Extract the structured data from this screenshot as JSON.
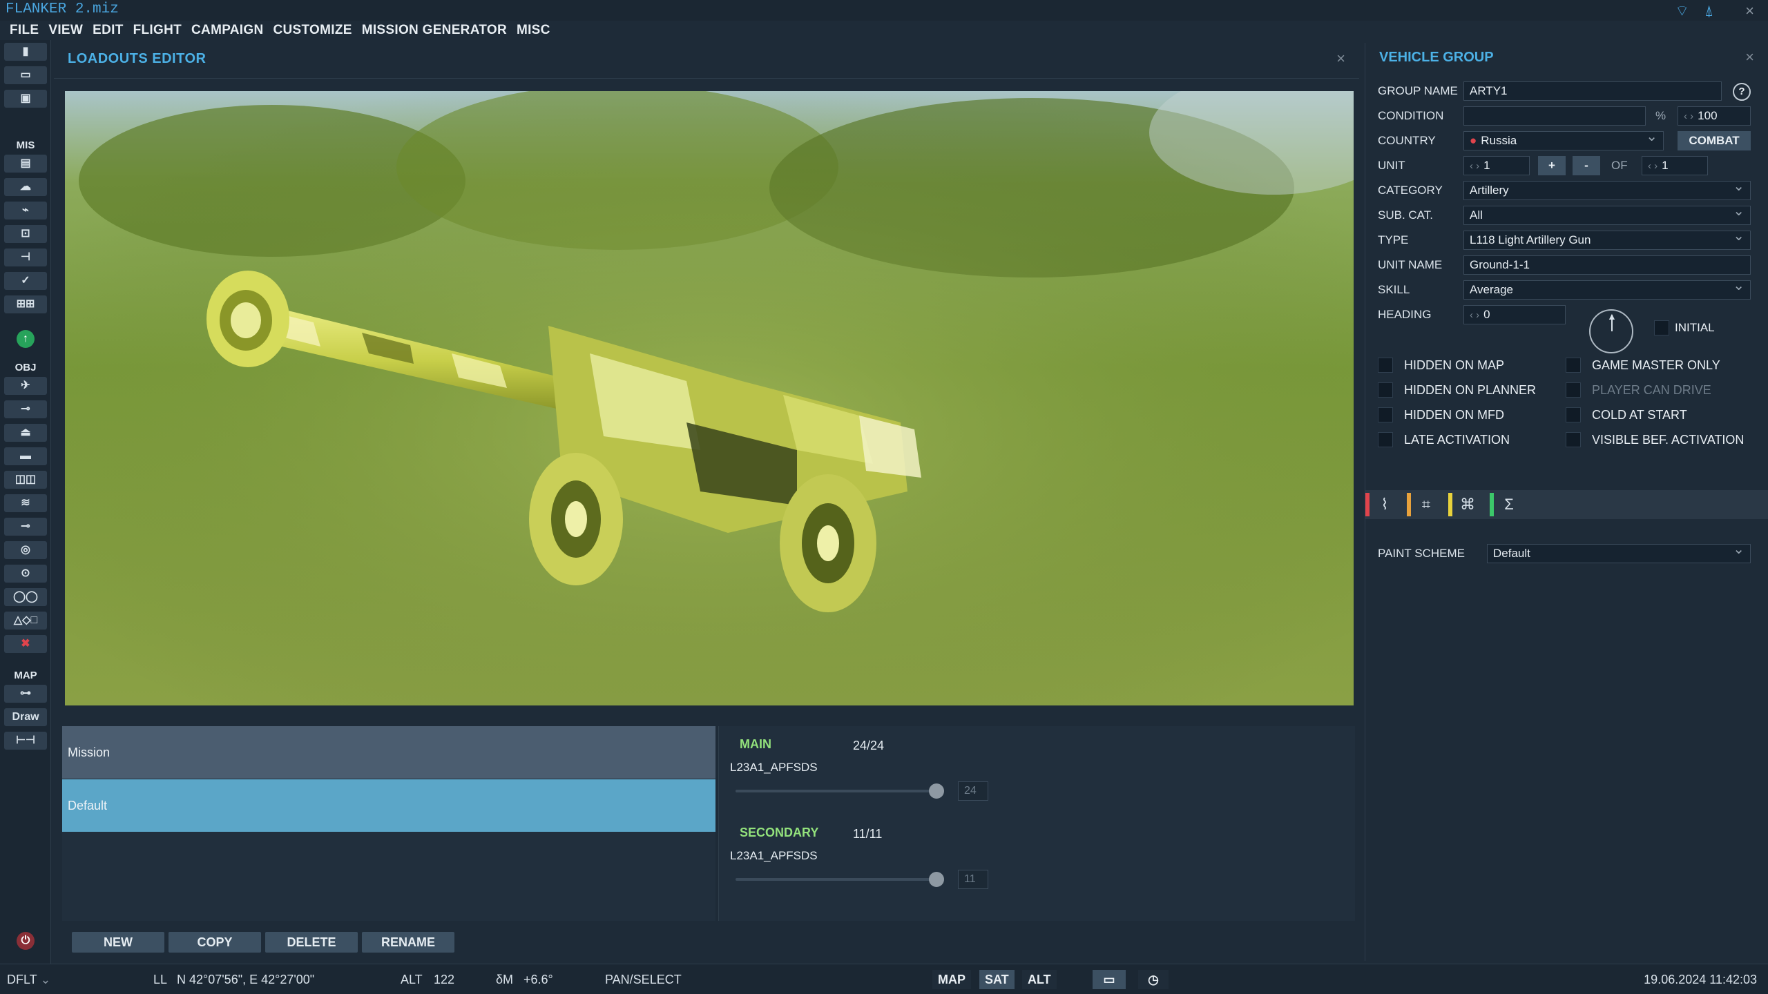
{
  "app": {
    "title": "FLANKER 2.miz"
  },
  "titlebar_icons": {
    "wifi": "wifi-icon",
    "antenna": "antenna-icon",
    "close": "×"
  },
  "menu": [
    "FILE",
    "VIEW",
    "EDIT",
    "FLIGHT",
    "CAMPAIGN",
    "CUSTOMIZE",
    "MISSION GENERATOR",
    "MISC"
  ],
  "left_toolbar": {
    "section_mis": "MIS",
    "section_obj": "OBJ",
    "section_map": "MAP",
    "draw_label": "Draw"
  },
  "loadouts": {
    "title": "LOADOUTS EDITOR",
    "close": "×",
    "list": [
      "Mission",
      "Default"
    ],
    "selected": "Default",
    "main": {
      "label": "MAIN",
      "count": "24/24",
      "weapon": "L23A1_APFSDS",
      "value": "24",
      "fraction": 1.0
    },
    "secondary": {
      "label": "SECONDARY",
      "count": "11/11",
      "weapon": "L23A1_APFSDS",
      "value": "11",
      "fraction": 1.0
    },
    "buttons": {
      "new": "NEW",
      "copy": "COPY",
      "delete": "DELETE",
      "rename": "RENAME"
    }
  },
  "vehicle_group": {
    "title": "VEHICLE GROUP",
    "close": "×",
    "labels": {
      "group_name": "GROUP NAME",
      "condition": "CONDITION",
      "country": "COUNTRY",
      "unit": "UNIT",
      "category": "CATEGORY",
      "sub_cat": "SUB. CAT.",
      "type": "TYPE",
      "unit_name": "UNIT NAME",
      "skill": "SKILL",
      "heading": "HEADING",
      "initial": "INITIAL",
      "of": "OF",
      "percent": "%",
      "paint_scheme": "PAINT SCHEME"
    },
    "values": {
      "group_name": "ARTY1",
      "condition": "",
      "condition_pct": "100",
      "country": "Russia",
      "unit": "1",
      "unit_of": "1",
      "category": "Artillery",
      "sub_cat": "All",
      "type": "L118 Light Artillery Gun",
      "unit_name": "Ground-1-1",
      "skill": "Average",
      "heading": "0",
      "paint_scheme": "Default"
    },
    "buttons": {
      "combat": "COMBAT",
      "plus": "+",
      "minus": "-",
      "help": "?"
    },
    "checkboxes_left": [
      "HIDDEN ON MAP",
      "HIDDEN ON PLANNER",
      "HIDDEN ON MFD",
      "LATE ACTIVATION"
    ],
    "checkboxes_right": [
      "GAME MASTER ONLY",
      "PLAYER CAN DRIVE",
      "COLD AT START",
      "VISIBLE BEF. ACTIVATION"
    ],
    "tab_icons": [
      "route-icon",
      "target-icon",
      "command-icon",
      "sigma-icon"
    ],
    "tab_colors": [
      "#e0444c",
      "#e8a23c",
      "#e8d23c",
      "#3cc86a"
    ],
    "country_color": "#e0444c"
  },
  "statusbar": {
    "profile": "DFLT",
    "coord_label": "LL",
    "coords": "N 42°07'56\", E 42°27'00\"",
    "alt_label": "ALT",
    "alt_value": "122",
    "mag_label": "δM",
    "mag_value": "+6.6°",
    "mode": "PAN/SELECT",
    "map_btn": "MAP",
    "sat_btn": "SAT",
    "alt_btn": "ALT",
    "datetime": "19.06.2024 11:42:03"
  }
}
